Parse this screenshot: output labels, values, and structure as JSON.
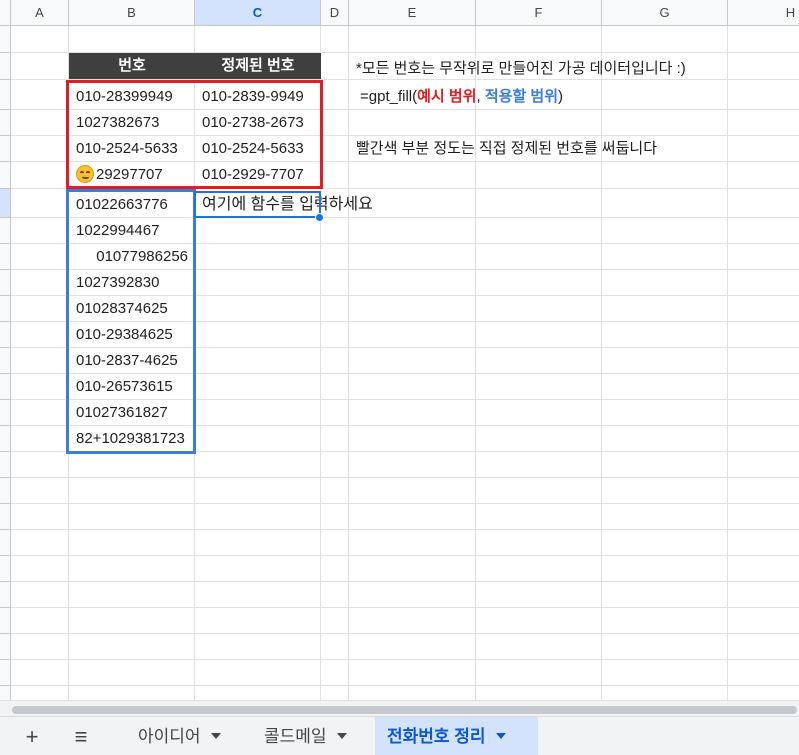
{
  "columns": [
    "A",
    "B",
    "C",
    "D",
    "E",
    "F",
    "G",
    "H"
  ],
  "active_column": "C",
  "table": {
    "headers": [
      "번호",
      "정제된 번호"
    ],
    "example_rows": [
      {
        "raw": "010-28399949",
        "clean": "010-2839-9949"
      },
      {
        "raw": "1027382673",
        "clean": "010-2738-2673"
      },
      {
        "raw": "010-2524-5633",
        "clean": "010-2524-5633"
      },
      {
        "raw": "29297707",
        "clean": "010-2929-7707",
        "emoji": true
      }
    ],
    "apply_rows": [
      "01022663776",
      "1022994467",
      "01077986256",
      "1027392830",
      "01028374625",
      "010-29384625",
      "010-2837-4625",
      "010-26573615",
      "01027361827",
      "82+1029381723"
    ],
    "input_cell_text": "여기에 함수를 입력하세요"
  },
  "notes": {
    "disclaimer": "*모든 번호는 무작위로 만들어진 가공 데이터입니다 :)",
    "formula_prefix": "=gpt_fill(",
    "formula_arg1": "예시 범위",
    "formula_sep": ", ",
    "formula_arg2": "적용할 범위",
    "formula_suffix": ")",
    "hint": "빨간색 부분 정도는 직접 정제된 번호를 써둡니다"
  },
  "colors": {
    "example_range": "#e51c23",
    "apply_range": "#3b7ddd",
    "selection": "#1a73e8",
    "header_bg": "#3f3f3f"
  },
  "sheet_bar": {
    "add_label": "+",
    "menu_label": "≡",
    "tabs": [
      {
        "label": "아이디어",
        "active": false
      },
      {
        "label": "콜드메일",
        "active": false
      },
      {
        "label": "전화번호 정리",
        "active": true
      }
    ]
  }
}
